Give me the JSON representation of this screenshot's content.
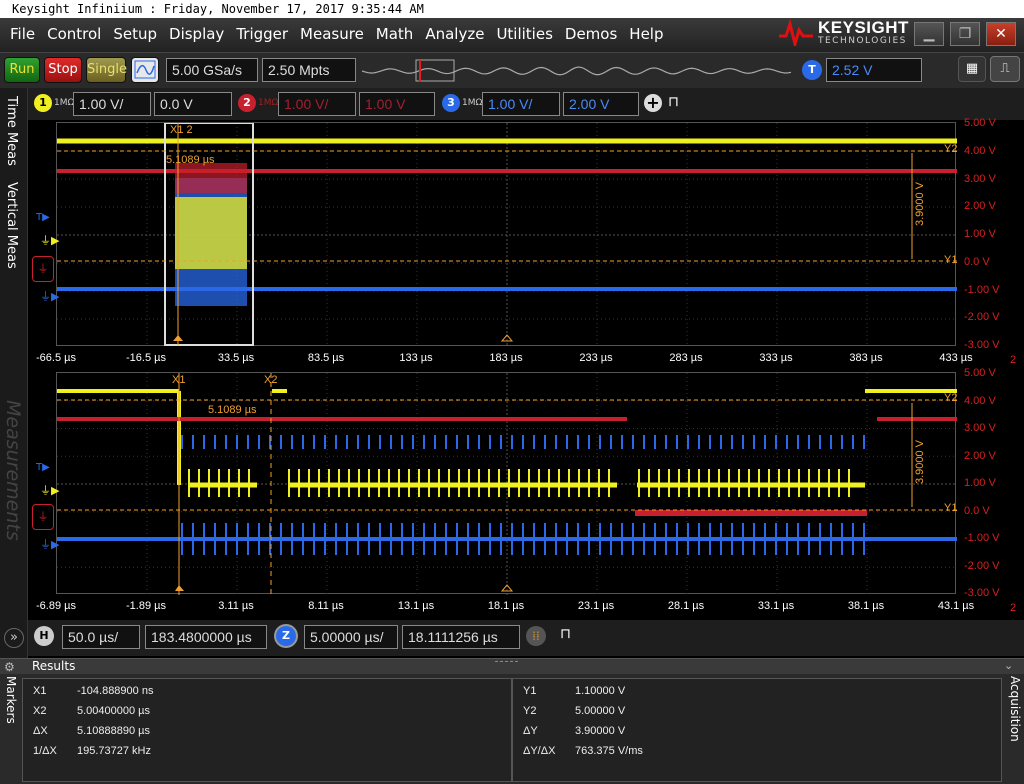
{
  "titlebar": {
    "text": "Keysight Infiniium : Friday, November 17, 2017 9:35:44 AM"
  },
  "menu": [
    "File",
    "Control",
    "Setup",
    "Display",
    "Trigger",
    "Measure",
    "Math",
    "Analyze",
    "Utilities",
    "Demos",
    "Help"
  ],
  "logo": {
    "line1": "KEYSIGHT",
    "line2": "TECHNOLOGIES"
  },
  "toolbar": {
    "run": "Run",
    "stop": "Stop",
    "single": "Single",
    "sample_rate": "5.00 GSa/s",
    "memory": "2.50 Mpts",
    "trigger_label": "T",
    "trigger_level": "2.52 V"
  },
  "channels": [
    {
      "num": "1",
      "imp": "1MΩ",
      "scale": "1.00 V/",
      "offset": "0.0 V",
      "color": "#f0f020"
    },
    {
      "num": "2",
      "imp": "1MΩ",
      "scale": "1.00 V/",
      "offset": "1.00 V",
      "color": "#c8202e"
    },
    {
      "num": "3",
      "imp": "1MΩ",
      "scale": "1.00 V/",
      "offset": "2.00 V",
      "color": "#2a6ae8"
    }
  ],
  "sidetabs": {
    "time_meas": "Time Meas",
    "vertical_meas": "Vertical Meas",
    "measurements": "Measurements"
  },
  "upper": {
    "x_ticks": [
      "-66.5 µs",
      "-16.5 µs",
      "33.5 µs",
      "83.5 µs",
      "133 µs",
      "183 µs",
      "233 µs",
      "283 µs",
      "333 µs",
      "383 µs",
      "433 µs"
    ],
    "y_ticks": [
      "5.00 V",
      "4.00 V",
      "3.00 V",
      "2.00 V",
      "1.00 V",
      "0.0 V",
      "-1.00 V",
      "-2.00 V",
      "-3.00 V"
    ],
    "marker_x": "X1 2",
    "delta_label": "5.1089 µs",
    "dy_label": "3.9000 V",
    "y2": "Y2",
    "y1": "Y1",
    "corner": "2"
  },
  "lower": {
    "x_ticks": [
      "-6.89 µs",
      "-1.89 µs",
      "3.11 µs",
      "8.11 µs",
      "13.1 µs",
      "18.1 µs",
      "23.1 µs",
      "28.1 µs",
      "33.1 µs",
      "38.1 µs",
      "43.1 µs"
    ],
    "y_ticks": [
      "5.00 V",
      "4.00 V",
      "3.00 V",
      "2.00 V",
      "1.00 V",
      "0.0 V",
      "-1.00 V",
      "-2.00 V",
      "-3.00 V"
    ],
    "x1": "X1",
    "x2": "X2",
    "delta_label": "5.1089 µs",
    "dy_label": "3.9000 V",
    "y2": "Y2",
    "y1": "Y1",
    "corner": "2"
  },
  "timebar": {
    "h_label": "H",
    "h_scale": "50.0 µs/",
    "h_pos": "183.4800000 µs",
    "z_label": "Z",
    "z_scale": "5.00000 µs/",
    "z_pos": "18.1111256 µs"
  },
  "results": {
    "title": "Results",
    "markers_tab": "Markers",
    "acq_tab": "Acquisition",
    "left": [
      {
        "k": "X1",
        "v": "-104.888900 ns"
      },
      {
        "k": "X2",
        "v": "5.00400000 µs"
      },
      {
        "k": "ΔX",
        "v": "5.10888890 µs"
      },
      {
        "k": "1/ΔX",
        "v": "195.73727 kHz"
      }
    ],
    "right": [
      {
        "k": "Y1",
        "v": "1.10000 V"
      },
      {
        "k": "Y2",
        "v": "5.00000 V"
      },
      {
        "k": "ΔY",
        "v": "3.90000 V"
      },
      {
        "k": "ΔY/ΔX",
        "v": "763.375 V/ms"
      }
    ]
  }
}
